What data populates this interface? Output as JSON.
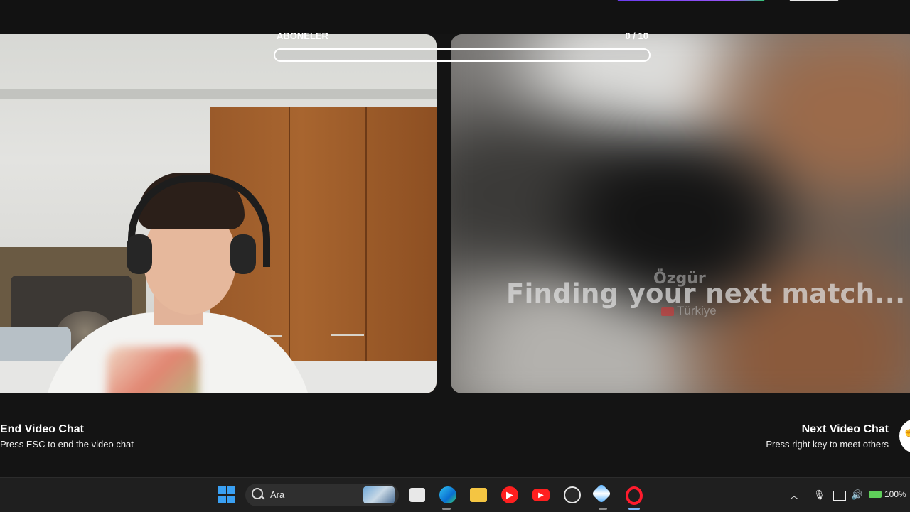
{
  "overlay": {
    "subscribers_label": "ABONELER",
    "subscribers_count": "0 / 10",
    "subscribers_progress": 0
  },
  "remote": {
    "status": "Finding your next match...",
    "name": "Özgür",
    "country": "Türkiye"
  },
  "controls": {
    "end_title": "End Video Chat",
    "end_hint": "Press ESC to end the video chat",
    "next_title": "Next Video Chat",
    "next_hint": "Press right key to meet others"
  },
  "taskbar": {
    "search_placeholder": "Ara",
    "apps": [
      "task-view",
      "edge",
      "file-explorer",
      "youtube-music",
      "youtube",
      "obs-studio",
      "tool-app",
      "opera"
    ],
    "battery": "100%"
  },
  "colors": {
    "background": "#141414",
    "progress_border": "#ffffff",
    "taskbar": "#1f1f1f",
    "accent_blue": "#3aa0f3"
  }
}
